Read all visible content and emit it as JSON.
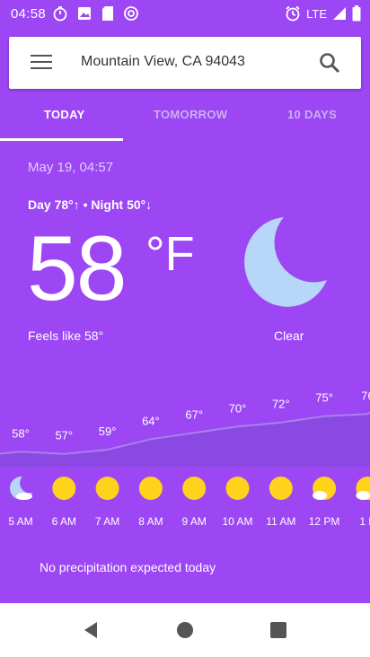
{
  "status_bar": {
    "time": "04:58",
    "network_label": "LTE",
    "left_icons": [
      "timer-icon",
      "image-icon",
      "sd-card-icon",
      "target-icon"
    ],
    "right_icons": [
      "alarm-icon",
      "signal-icon",
      "battery-icon"
    ]
  },
  "search": {
    "query": "Mountain View, CA 94043",
    "menu_icon": "hamburger-menu-icon",
    "search_icon": "search-icon"
  },
  "tabs": [
    {
      "label": "TODAY",
      "selected": true
    },
    {
      "label": "TOMORROW",
      "selected": false
    },
    {
      "label": "10 DAYS",
      "selected": false
    }
  ],
  "current": {
    "datetime": "May 19, 04:57",
    "day_night": "Day 78°↑ • Night 50°↓",
    "temperature": "58",
    "unit": "°F",
    "feels_like": "Feels like 58°",
    "condition": "Clear",
    "condition_icon": "crescent-moon-icon"
  },
  "hourly": [
    {
      "time": "5 AM",
      "temp": "58°",
      "icon": "moon-icon"
    },
    {
      "time": "6 AM",
      "temp": "57°",
      "icon": "sun-icon"
    },
    {
      "time": "7 AM",
      "temp": "59°",
      "icon": "sun-icon"
    },
    {
      "time": "8 AM",
      "temp": "64°",
      "icon": "sun-icon"
    },
    {
      "time": "9 AM",
      "temp": "67°",
      "icon": "sun-icon"
    },
    {
      "time": "10 AM",
      "temp": "70°",
      "icon": "sun-icon"
    },
    {
      "time": "11 AM",
      "temp": "72°",
      "icon": "sun-icon"
    },
    {
      "time": "12 PM",
      "temp": "75°",
      "icon": "partly-cloudy-icon"
    },
    {
      "time": "1 P",
      "temp": "76",
      "icon": "partly-cloudy-icon"
    }
  ],
  "precip_text": "No precipitation expected today",
  "nav": {
    "icons": [
      "back-icon",
      "home-icon",
      "recents-icon"
    ]
  },
  "colors": {
    "background": "#9c46f4",
    "sun": "#ffd21c",
    "moon": "#b7d6f8",
    "curve_fill": "#8a49e2"
  }
}
